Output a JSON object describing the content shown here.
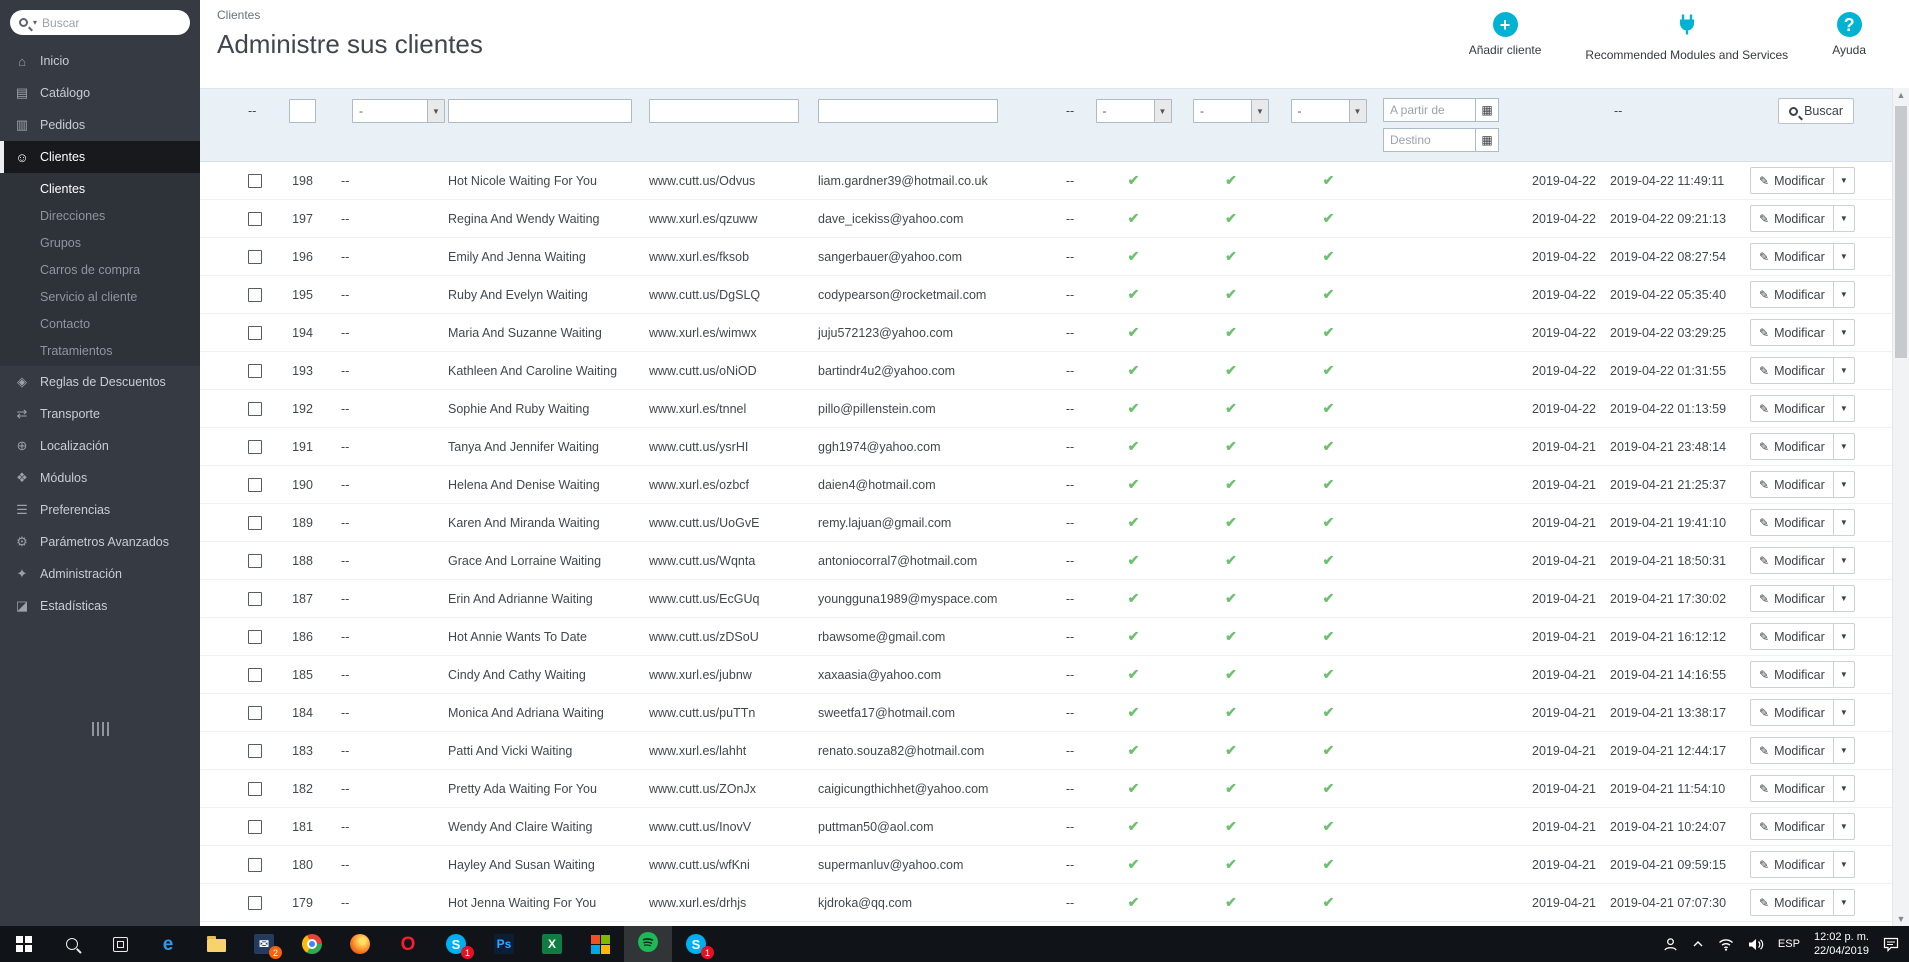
{
  "colors": {
    "accent": "#00b3d3",
    "check_green": "#6fc172",
    "sidebar_bg": "#363a42",
    "filter_bg": "#e9f1f7"
  },
  "sidebar": {
    "search": {
      "placeholder": "Buscar"
    },
    "items": [
      {
        "label": "Inicio",
        "icon": "home"
      },
      {
        "label": "Catálogo",
        "icon": "catalog"
      },
      {
        "label": "Pedidos",
        "icon": "orders"
      },
      {
        "label": "Clientes",
        "icon": "customers",
        "active": true,
        "activeChild": 0,
        "children": [
          "Clientes",
          "Direcciones",
          "Grupos",
          "Carros de compra",
          "Servicio al cliente",
          "Contacto",
          "Tratamientos"
        ]
      },
      {
        "label": "Reglas de Descuentos",
        "icon": "discounts"
      },
      {
        "label": "Transporte",
        "icon": "shipping"
      },
      {
        "label": "Localización",
        "icon": "localization"
      },
      {
        "label": "Módulos",
        "icon": "modules"
      },
      {
        "label": "Preferencias",
        "icon": "preferences"
      },
      {
        "label": "Parámetros Avanzados",
        "icon": "advanced"
      },
      {
        "label": "Administración",
        "icon": "admin"
      },
      {
        "label": "Estadísticas",
        "icon": "stats"
      }
    ]
  },
  "header": {
    "breadcrumb": "Clientes",
    "title": "Administre sus clientes",
    "actions": [
      {
        "label": "Añadir cliente",
        "icon": "add-client"
      },
      {
        "label": "Recommended Modules and Services",
        "icon": "recommended-modules"
      },
      {
        "label": "Ayuda",
        "icon": "help"
      }
    ]
  },
  "filters": {
    "empty": "--",
    "select_value": "-",
    "date_from_placeholder": "A partir de",
    "date_to_placeholder": "Destino",
    "search_button": "Buscar"
  },
  "table": {
    "action_label": "Modificar",
    "rows": [
      {
        "id": "198",
        "social": "--",
        "name": "Hot Nicole Waiting For You",
        "url": "www.cutt.us/Odvus",
        "email": "liam.gardner39@hotmail.co.uk",
        "sales": "--",
        "enabled": true,
        "newsletter": true,
        "optin": true,
        "registration": "2019-04-22",
        "last_visit": "2019-04-22 11:49:11"
      },
      {
        "id": "197",
        "social": "--",
        "name": "Regina And Wendy Waiting",
        "url": "www.xurl.es/qzuww",
        "email": "dave_icekiss@yahoo.com",
        "sales": "--",
        "enabled": true,
        "newsletter": true,
        "optin": true,
        "registration": "2019-04-22",
        "last_visit": "2019-04-22 09:21:13"
      },
      {
        "id": "196",
        "social": "--",
        "name": "Emily And Jenna Waiting",
        "url": "www.xurl.es/fksob",
        "email": "sangerbauer@yahoo.com",
        "sales": "--",
        "enabled": true,
        "newsletter": true,
        "optin": true,
        "registration": "2019-04-22",
        "last_visit": "2019-04-22 08:27:54"
      },
      {
        "id": "195",
        "social": "--",
        "name": "Ruby And Evelyn Waiting",
        "url": "www.cutt.us/DgSLQ",
        "email": "codypearson@rocketmail.com",
        "sales": "--",
        "enabled": true,
        "newsletter": true,
        "optin": true,
        "registration": "2019-04-22",
        "last_visit": "2019-04-22 05:35:40"
      },
      {
        "id": "194",
        "social": "--",
        "name": "Maria And Suzanne Waiting",
        "url": "www.xurl.es/wimwx",
        "email": "juju572123@yahoo.com",
        "sales": "--",
        "enabled": true,
        "newsletter": true,
        "optin": true,
        "registration": "2019-04-22",
        "last_visit": "2019-04-22 03:29:25"
      },
      {
        "id": "193",
        "social": "--",
        "name": "Kathleen And Caroline Waiting",
        "url": "www.cutt.us/oNiOD",
        "email": "bartindr4u2@yahoo.com",
        "sales": "--",
        "enabled": true,
        "newsletter": true,
        "optin": true,
        "registration": "2019-04-22",
        "last_visit": "2019-04-22 01:31:55"
      },
      {
        "id": "192",
        "social": "--",
        "name": "Sophie And Ruby Waiting",
        "url": "www.xurl.es/tnnel",
        "email": "pillo@pillenstein.com",
        "sales": "--",
        "enabled": true,
        "newsletter": true,
        "optin": true,
        "registration": "2019-04-22",
        "last_visit": "2019-04-22 01:13:59"
      },
      {
        "id": "191",
        "social": "--",
        "name": "Tanya And Jennifer Waiting",
        "url": "www.cutt.us/ysrHI",
        "email": "ggh1974@yahoo.com",
        "sales": "--",
        "enabled": true,
        "newsletter": true,
        "optin": true,
        "registration": "2019-04-21",
        "last_visit": "2019-04-21 23:48:14"
      },
      {
        "id": "190",
        "social": "--",
        "name": "Helena And Denise Waiting",
        "url": "www.xurl.es/ozbcf",
        "email": "daien4@hotmail.com",
        "sales": "--",
        "enabled": true,
        "newsletter": true,
        "optin": true,
        "registration": "2019-04-21",
        "last_visit": "2019-04-21 21:25:37"
      },
      {
        "id": "189",
        "social": "--",
        "name": "Karen And Miranda Waiting",
        "url": "www.cutt.us/UoGvE",
        "email": "remy.lajuan@gmail.com",
        "sales": "--",
        "enabled": true,
        "newsletter": true,
        "optin": true,
        "registration": "2019-04-21",
        "last_visit": "2019-04-21 19:41:10"
      },
      {
        "id": "188",
        "social": "--",
        "name": "Grace And Lorraine Waiting",
        "url": "www.cutt.us/Wqnta",
        "email": "antoniocorral7@hotmail.com",
        "sales": "--",
        "enabled": true,
        "newsletter": true,
        "optin": true,
        "registration": "2019-04-21",
        "last_visit": "2019-04-21 18:50:31"
      },
      {
        "id": "187",
        "social": "--",
        "name": "Erin And Adrianne Waiting",
        "url": "www.cutt.us/EcGUq",
        "email": "youngguna1989@myspace.com",
        "sales": "--",
        "enabled": true,
        "newsletter": true,
        "optin": true,
        "registration": "2019-04-21",
        "last_visit": "2019-04-21 17:30:02"
      },
      {
        "id": "186",
        "social": "--",
        "name": "Hot Annie Wants To Date",
        "url": "www.cutt.us/zDSoU",
        "email": "rbawsome@gmail.com",
        "sales": "--",
        "enabled": true,
        "newsletter": true,
        "optin": true,
        "registration": "2019-04-21",
        "last_visit": "2019-04-21 16:12:12"
      },
      {
        "id": "185",
        "social": "--",
        "name": "Cindy And Cathy Waiting",
        "url": "www.xurl.es/jubnw",
        "email": "xaxaasia@yahoo.com",
        "sales": "--",
        "enabled": true,
        "newsletter": true,
        "optin": true,
        "registration": "2019-04-21",
        "last_visit": "2019-04-21 14:16:55"
      },
      {
        "id": "184",
        "social": "--",
        "name": "Monica And Adriana Waiting",
        "url": "www.cutt.us/puTTn",
        "email": "sweetfa17@hotmail.com",
        "sales": "--",
        "enabled": true,
        "newsletter": true,
        "optin": true,
        "registration": "2019-04-21",
        "last_visit": "2019-04-21 13:38:17"
      },
      {
        "id": "183",
        "social": "--",
        "name": "Patti And Vicki Waiting",
        "url": "www.xurl.es/lahht",
        "email": "renato.souza82@hotmail.com",
        "sales": "--",
        "enabled": true,
        "newsletter": true,
        "optin": true,
        "registration": "2019-04-21",
        "last_visit": "2019-04-21 12:44:17"
      },
      {
        "id": "182",
        "social": "--",
        "name": "Pretty Ada Waiting For You",
        "url": "www.cutt.us/ZOnJx",
        "email": "caigicungthichhet@yahoo.com",
        "sales": "--",
        "enabled": true,
        "newsletter": true,
        "optin": true,
        "registration": "2019-04-21",
        "last_visit": "2019-04-21 11:54:10"
      },
      {
        "id": "181",
        "social": "--",
        "name": "Wendy And Claire Waiting",
        "url": "www.cutt.us/InovV",
        "email": "puttman50@aol.com",
        "sales": "--",
        "enabled": true,
        "newsletter": true,
        "optin": true,
        "registration": "2019-04-21",
        "last_visit": "2019-04-21 10:24:07"
      },
      {
        "id": "180",
        "social": "--",
        "name": "Hayley And Susan Waiting",
        "url": "www.cutt.us/wfKni",
        "email": "supermanluv@yahoo.com",
        "sales": "--",
        "enabled": true,
        "newsletter": true,
        "optin": true,
        "registration": "2019-04-21",
        "last_visit": "2019-04-21 09:59:15"
      },
      {
        "id": "179",
        "social": "--",
        "name": "Hot Jenna Waiting For You",
        "url": "www.xurl.es/drhjs",
        "email": "kjdroka@qq.com",
        "sales": "--",
        "enabled": true,
        "newsletter": true,
        "optin": true,
        "registration": "2019-04-21",
        "last_visit": "2019-04-21 07:07:30"
      }
    ]
  },
  "taskbar": {
    "language": "ESP",
    "time": "12:02 p. m.",
    "date": "22/04/2019",
    "apps": [
      {
        "name": "start",
        "type": "win"
      },
      {
        "name": "taskbar-search",
        "type": "search"
      },
      {
        "name": "task-view",
        "type": "taskview"
      },
      {
        "name": "edge",
        "type": "letter",
        "letter": "e",
        "color": "#2f9ae3"
      },
      {
        "name": "file-explorer",
        "type": "folder"
      },
      {
        "name": "mail",
        "type": "mail",
        "badge": "2",
        "badgeColor": "#f7630c"
      },
      {
        "name": "chrome",
        "type": "chrome"
      },
      {
        "name": "firefox",
        "type": "firefox"
      },
      {
        "name": "opera",
        "type": "letter",
        "letter": "O",
        "color": "#ff1b2d"
      },
      {
        "name": "skype",
        "type": "disc",
        "letter": "S",
        "bg": "#00aff0",
        "badge": "1",
        "badgeColor": "#e81123"
      },
      {
        "name": "photoshop",
        "type": "sq",
        "letter": "Ps",
        "bg": "#0c1e36",
        "fg": "#31a8ff"
      },
      {
        "name": "excel",
        "type": "sq",
        "letter": "X",
        "bg": "#107c41",
        "fg": "#ffffff"
      },
      {
        "name": "store",
        "type": "msgrid"
      },
      {
        "name": "spotify",
        "type": "spotify",
        "active": true
      },
      {
        "name": "skype-2",
        "type": "disc",
        "letter": "S",
        "bg": "#00aff0",
        "badge": "1",
        "badgeColor": "#e81123"
      }
    ]
  }
}
